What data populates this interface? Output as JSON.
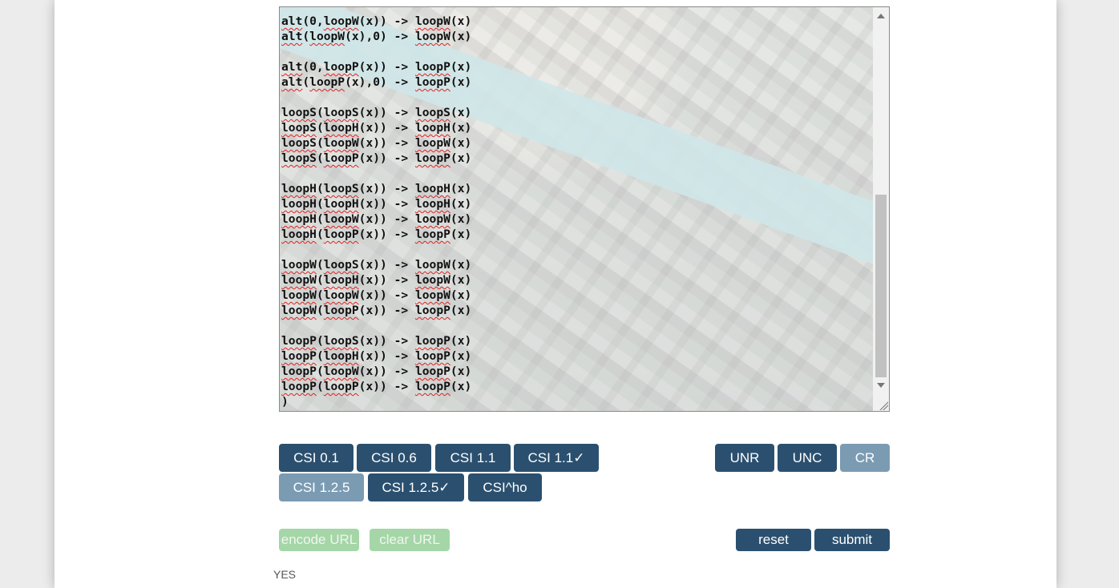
{
  "editor": {
    "lines": [
      [
        {
          "t": "alt",
          "s": 1
        },
        {
          "t": "(0,"
        },
        {
          "t": "loopW",
          "s": 1
        },
        {
          "t": "(x)) -> "
        },
        {
          "t": "loopW",
          "s": 1
        },
        {
          "t": "(x)"
        }
      ],
      [
        {
          "t": "alt",
          "s": 1
        },
        {
          "t": "("
        },
        {
          "t": "loopW",
          "s": 1
        },
        {
          "t": "(x),0) -> "
        },
        {
          "t": "loopW",
          "s": 1
        },
        {
          "t": "(x)"
        }
      ],
      [],
      [
        {
          "t": "alt",
          "s": 1
        },
        {
          "t": "(0,"
        },
        {
          "t": "loopP",
          "s": 1
        },
        {
          "t": "(x)) -> "
        },
        {
          "t": "loopP",
          "s": 1
        },
        {
          "t": "(x)"
        }
      ],
      [
        {
          "t": "alt",
          "s": 1
        },
        {
          "t": "("
        },
        {
          "t": "loopP",
          "s": 1
        },
        {
          "t": "(x),0) -> "
        },
        {
          "t": "loopP",
          "s": 1
        },
        {
          "t": "(x)"
        }
      ],
      [],
      [
        {
          "t": "loopS",
          "s": 1
        },
        {
          "t": "("
        },
        {
          "t": "loopS",
          "s": 1
        },
        {
          "t": "(x)) -> "
        },
        {
          "t": "loopS",
          "s": 1
        },
        {
          "t": "(x)"
        }
      ],
      [
        {
          "t": "loopS",
          "s": 1
        },
        {
          "t": "("
        },
        {
          "t": "loopH",
          "s": 1
        },
        {
          "t": "(x)) -> "
        },
        {
          "t": "loopH",
          "s": 1
        },
        {
          "t": "(x)"
        }
      ],
      [
        {
          "t": "loopS",
          "s": 1
        },
        {
          "t": "("
        },
        {
          "t": "loopW",
          "s": 1
        },
        {
          "t": "(x)) -> "
        },
        {
          "t": "loopW",
          "s": 1
        },
        {
          "t": "(x)"
        }
      ],
      [
        {
          "t": "loopS",
          "s": 1
        },
        {
          "t": "("
        },
        {
          "t": "loopP",
          "s": 1
        },
        {
          "t": "(x)) -> "
        },
        {
          "t": "loopP",
          "s": 1
        },
        {
          "t": "(x)"
        }
      ],
      [],
      [
        {
          "t": "loopH",
          "s": 1
        },
        {
          "t": "("
        },
        {
          "t": "loopS",
          "s": 1
        },
        {
          "t": "(x)) -> "
        },
        {
          "t": "loopH",
          "s": 1
        },
        {
          "t": "(x)"
        }
      ],
      [
        {
          "t": "loopH",
          "s": 1
        },
        {
          "t": "("
        },
        {
          "t": "loopH",
          "s": 1
        },
        {
          "t": "(x)) -> "
        },
        {
          "t": "loopH",
          "s": 1
        },
        {
          "t": "(x)"
        }
      ],
      [
        {
          "t": "loopH",
          "s": 1
        },
        {
          "t": "("
        },
        {
          "t": "loopW",
          "s": 1
        },
        {
          "t": "(x)) -> "
        },
        {
          "t": "loopW",
          "s": 1
        },
        {
          "t": "(x)"
        }
      ],
      [
        {
          "t": "loopH",
          "s": 1
        },
        {
          "t": "("
        },
        {
          "t": "loopP",
          "s": 1
        },
        {
          "t": "(x)) -> "
        },
        {
          "t": "loopP",
          "s": 1
        },
        {
          "t": "(x)"
        }
      ],
      [],
      [
        {
          "t": "loopW",
          "s": 1
        },
        {
          "t": "("
        },
        {
          "t": "loopS",
          "s": 1
        },
        {
          "t": "(x)) -> "
        },
        {
          "t": "loopW",
          "s": 1
        },
        {
          "t": "(x)"
        }
      ],
      [
        {
          "t": "loopW",
          "s": 1
        },
        {
          "t": "("
        },
        {
          "t": "loopH",
          "s": 1
        },
        {
          "t": "(x)) -> "
        },
        {
          "t": "loopW",
          "s": 1
        },
        {
          "t": "(x)"
        }
      ],
      [
        {
          "t": "loopW",
          "s": 1
        },
        {
          "t": "("
        },
        {
          "t": "loopW",
          "s": 1
        },
        {
          "t": "(x)) -> "
        },
        {
          "t": "loopW",
          "s": 1
        },
        {
          "t": "(x)"
        }
      ],
      [
        {
          "t": "loopW",
          "s": 1
        },
        {
          "t": "("
        },
        {
          "t": "loopP",
          "s": 1
        },
        {
          "t": "(x)) -> "
        },
        {
          "t": "loopP",
          "s": 1
        },
        {
          "t": "(x)"
        }
      ],
      [],
      [
        {
          "t": "loopP",
          "s": 1
        },
        {
          "t": "("
        },
        {
          "t": "loopS",
          "s": 1
        },
        {
          "t": "(x)) -> "
        },
        {
          "t": "loopP",
          "s": 1
        },
        {
          "t": "(x)"
        }
      ],
      [
        {
          "t": "loopP",
          "s": 1
        },
        {
          "t": "("
        },
        {
          "t": "loopH",
          "s": 1
        },
        {
          "t": "(x)) -> "
        },
        {
          "t": "loopP",
          "s": 1
        },
        {
          "t": "(x)"
        }
      ],
      [
        {
          "t": "loopP",
          "s": 1
        },
        {
          "t": "("
        },
        {
          "t": "loopW",
          "s": 1
        },
        {
          "t": "(x)) -> "
        },
        {
          "t": "loopP",
          "s": 1
        },
        {
          "t": "(x)"
        }
      ],
      [
        {
          "t": "loopP",
          "s": 1
        },
        {
          "t": "("
        },
        {
          "t": "loopP",
          "s": 1
        },
        {
          "t": "(x)) -> "
        },
        {
          "t": "loopP",
          "s": 1
        },
        {
          "t": "(x)"
        }
      ],
      [
        {
          "t": ")"
        }
      ]
    ]
  },
  "categories": {
    "csi_0_1": "CSI 0.1",
    "csi_0_6": "CSI 0.6",
    "csi_1_1": "CSI 1.1",
    "csi_1_1_check": "CSI 1.1✓",
    "csi_1_2_5": "CSI 1.2.5",
    "csi_1_2_5_check": "CSI 1.2.5✓",
    "csi_ho": "CSI^ho",
    "unr": "UNR",
    "unc": "UNC",
    "cr": "CR"
  },
  "actions": {
    "encode_url": "encode URL",
    "clear_url": "clear URL",
    "reset": "reset",
    "submit": "submit"
  },
  "result": "YES",
  "colors": {
    "button": "#2b506f",
    "button_selected": "#7b9bb3",
    "url_button": "#a5d6a7",
    "squiggle": "#e02020"
  }
}
